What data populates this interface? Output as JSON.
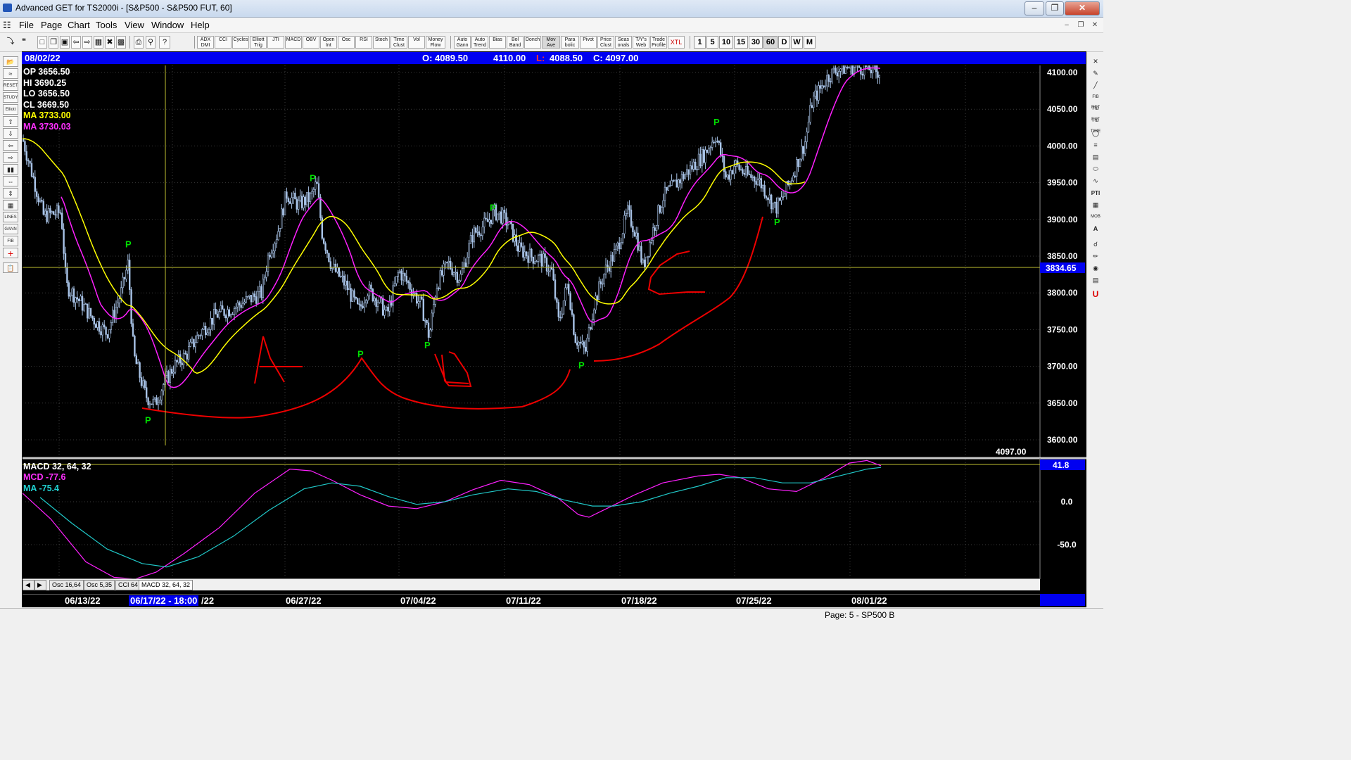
{
  "window": {
    "title": "Advanced GET for TS2000i - [S&P500 - S&P500 FUT, 60]",
    "minimize": "–",
    "maximize": "❐",
    "close": "✕"
  },
  "menu": [
    "File",
    "Page",
    "Chart",
    "Tools",
    "View",
    "Window",
    "Help"
  ],
  "toolbar": {
    "studies": [
      "ADX DMI",
      "CCI",
      "Cycles",
      "Elliott Trig",
      "JTI",
      "MACD",
      "OBV",
      "Open Int",
      "Osc",
      "RSI",
      "Stoch",
      "Time Clust",
      "Vol",
      "Money Flow",
      "Auto Gann",
      "Auto Trend",
      "Bias",
      "Bol Band",
      "Donch",
      "Mov Ave",
      "Para bolic",
      "Pivot",
      "Price Clust",
      "Seas onals",
      "T/Y's Web",
      "Trade Profile",
      "XTL"
    ],
    "timeframes": [
      "1",
      "5",
      "10",
      "15",
      "30",
      "60",
      "D",
      "W",
      "M"
    ],
    "selected_timeframe": "60"
  },
  "chart": {
    "date": "08/02/22",
    "open": "O: 4089.50",
    "high": "4110.00",
    "low_label": "L:",
    "low": "4088.50",
    "close": "C: 4097.00",
    "info": {
      "op": "OP  3656.50",
      "hi": "HI   3690.25",
      "lo": "LO  3656.50",
      "cl": "CL  3669.50",
      "ma1": "MA  3733.00",
      "ma2": "MA  3730.03"
    },
    "price_axis": [
      "4100.00",
      "4050.00",
      "4000.00",
      "3950.00",
      "3900.00",
      "3850.00",
      "3800.00",
      "3750.00",
      "3700.00",
      "3650.00",
      "3600.00"
    ],
    "cursor_price": "3834.65",
    "last_price": "4097.00",
    "pivot_label": "P",
    "annotations": [
      "A",
      "B",
      "C"
    ],
    "colors": {
      "background": "#000000",
      "candles": "#a9c4e8",
      "ma_fast": "#ffff00",
      "ma_slow": "#ff20ff",
      "pivot": "#00dd00",
      "drawing": "#ee0000",
      "header": "#0000f0"
    }
  },
  "macd": {
    "title": "MACD 32, 64, 32",
    "mcd": "MCD -77.6",
    "ma": "MA   -75.4",
    "axis": [
      "0.0",
      "-50.0"
    ],
    "value": "41.8"
  },
  "osc_tabs": [
    "Osc 16,64",
    "Osc 5,35",
    "CCI 64",
    "MACD 32, 64, 32"
  ],
  "dates": [
    "06/13/22",
    "06/17/22 - 18:00",
    "/22",
    "06/27/22",
    "07/04/22",
    "07/11/22",
    "07/18/22",
    "07/25/22",
    "08/01/22"
  ],
  "status": "Page: 5 - SP500 B"
}
